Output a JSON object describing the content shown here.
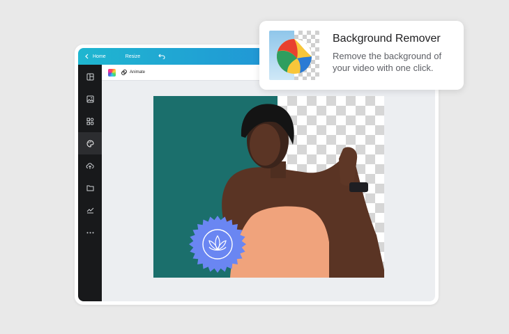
{
  "editor": {
    "topbar": {
      "home_label": "Home",
      "resize_label": "Resize"
    },
    "toolbar": {
      "animate_label": "Animate"
    },
    "sidebar": {
      "items": [
        {
          "icon": "layout-icon"
        },
        {
          "icon": "image-icon"
        },
        {
          "icon": "elements-icon"
        },
        {
          "icon": "palette-icon",
          "active": true
        },
        {
          "icon": "upload-cloud-icon"
        },
        {
          "icon": "folder-icon"
        },
        {
          "icon": "chart-line-icon"
        },
        {
          "icon": "more-icon"
        }
      ]
    },
    "colors": {
      "accent": "#2196d6",
      "sidebar": "#18191b",
      "canvas_bg": "#1b6f6c",
      "badge": "#6a86f2",
      "top": "#e9e9e9"
    }
  },
  "feature_card": {
    "title": "Background Remover",
    "description": "Remove the background of your video with one click."
  }
}
